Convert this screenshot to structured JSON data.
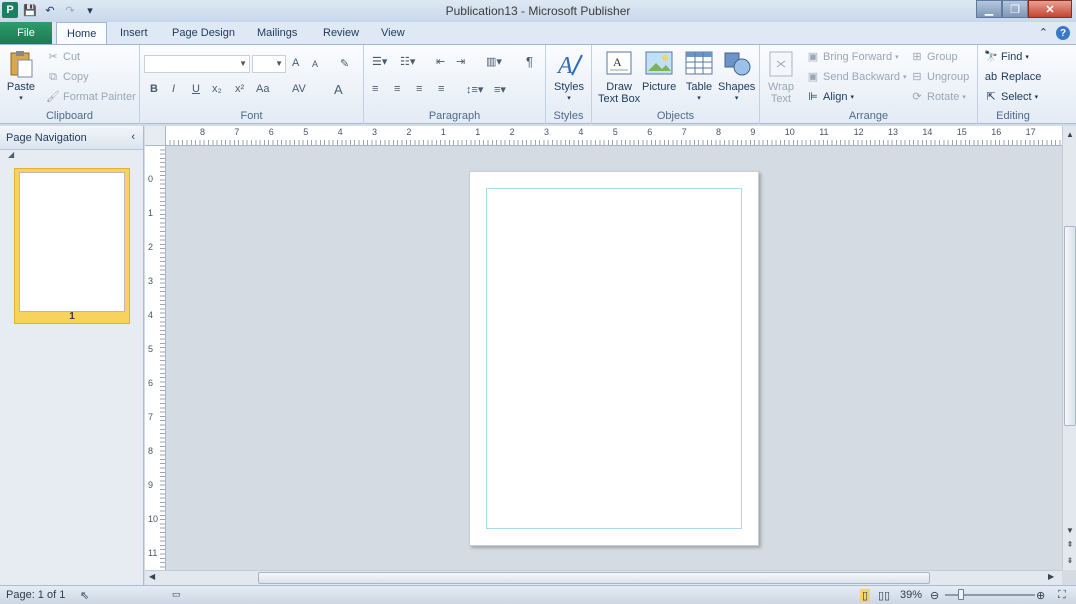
{
  "window": {
    "title": "Publication13  -  Microsoft Publisher"
  },
  "tabs": [
    {
      "label": "File"
    },
    {
      "label": "Home"
    },
    {
      "label": "Insert"
    },
    {
      "label": "Page Design"
    },
    {
      "label": "Mailings"
    },
    {
      "label": "Review"
    },
    {
      "label": "View"
    }
  ],
  "ribbon": {
    "clipboard": {
      "label": "Clipboard",
      "paste": "Paste",
      "cut": "Cut",
      "copy": "Copy",
      "format_painter": "Format Painter"
    },
    "font": {
      "label": "Font",
      "bold": "B",
      "italic": "I",
      "underline": "U",
      "subscript": "x₂",
      "superscript": "x²",
      "change_case": "Aa",
      "grow": "A",
      "shrink": "A",
      "spacing": "AV",
      "color": "A"
    },
    "paragraph": {
      "label": "Paragraph",
      "pilcrow": "¶"
    },
    "styles": {
      "label": "Styles",
      "button": "Styles"
    },
    "objects": {
      "label": "Objects",
      "draw_text_box_1": "Draw",
      "draw_text_box_2": "Text Box",
      "picture": "Picture",
      "table": "Table",
      "shapes": "Shapes"
    },
    "arrange": {
      "label": "Arrange",
      "wrap_text_1": "Wrap",
      "wrap_text_2": "Text",
      "bring_forward": "Bring Forward",
      "send_backward": "Send Backward",
      "align": "Align",
      "group": "Group",
      "ungroup": "Ungroup",
      "rotate": "Rotate"
    },
    "editing": {
      "label": "Editing",
      "find": "Find",
      "replace": "Replace",
      "select": "Select"
    }
  },
  "page_nav": {
    "title": "Page Navigation",
    "page_number": "1"
  },
  "ruler_h": [
    "8",
    "7",
    "6",
    "5",
    "4",
    "3",
    "2",
    "1",
    "1",
    "2",
    "3",
    "4",
    "5",
    "6",
    "7",
    "8",
    "9",
    "10",
    "11",
    "12",
    "13",
    "14",
    "15",
    "16",
    "17"
  ],
  "ruler_v": [
    "0",
    "1",
    "2",
    "3",
    "4",
    "5",
    "6",
    "7",
    "8",
    "9",
    "10",
    "11"
  ],
  "status": {
    "page": "Page: 1 of 1",
    "zoom": "39%"
  }
}
